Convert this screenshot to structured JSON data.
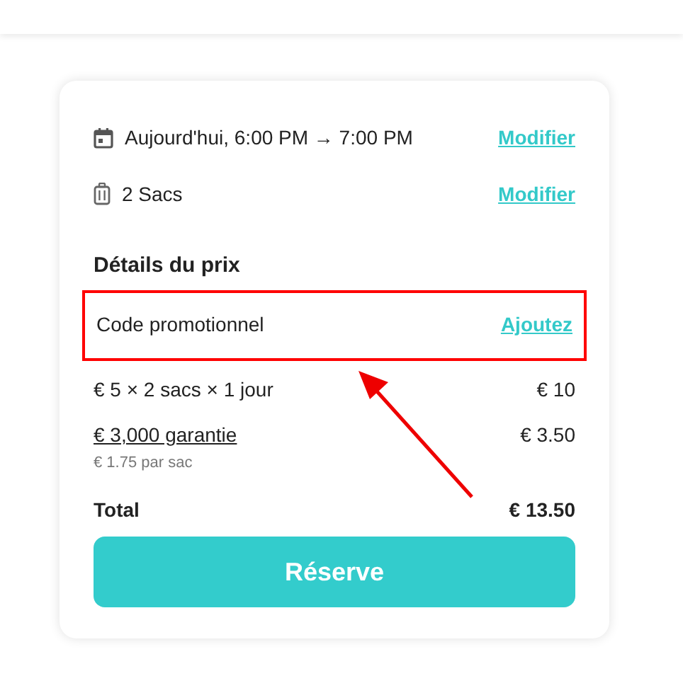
{
  "booking": [
    {
      "kind": "calendar",
      "text": "Aujourd'hui, 6:00 PM → 7:00 PM",
      "action": "Modifier"
    },
    {
      "kind": "luggage",
      "text": "2 Sacs",
      "action": "Modifier"
    }
  ],
  "price_details": {
    "title": "Détails du prix",
    "promo": {
      "label": "Code promotionnel",
      "action": "Ajoutez",
      "highlighted": true
    },
    "lines": [
      {
        "label": "€ 5 × 2 sacs × 1 jour",
        "amount": "€ 10",
        "underlined": false
      },
      {
        "label": "€ 3,000 garantie",
        "amount": "€ 3.50",
        "underlined": true,
        "note": "€ 1.75 par sac"
      }
    ],
    "total": {
      "label": "Total",
      "amount": "€ 13.50"
    }
  },
  "button": "Réserve"
}
